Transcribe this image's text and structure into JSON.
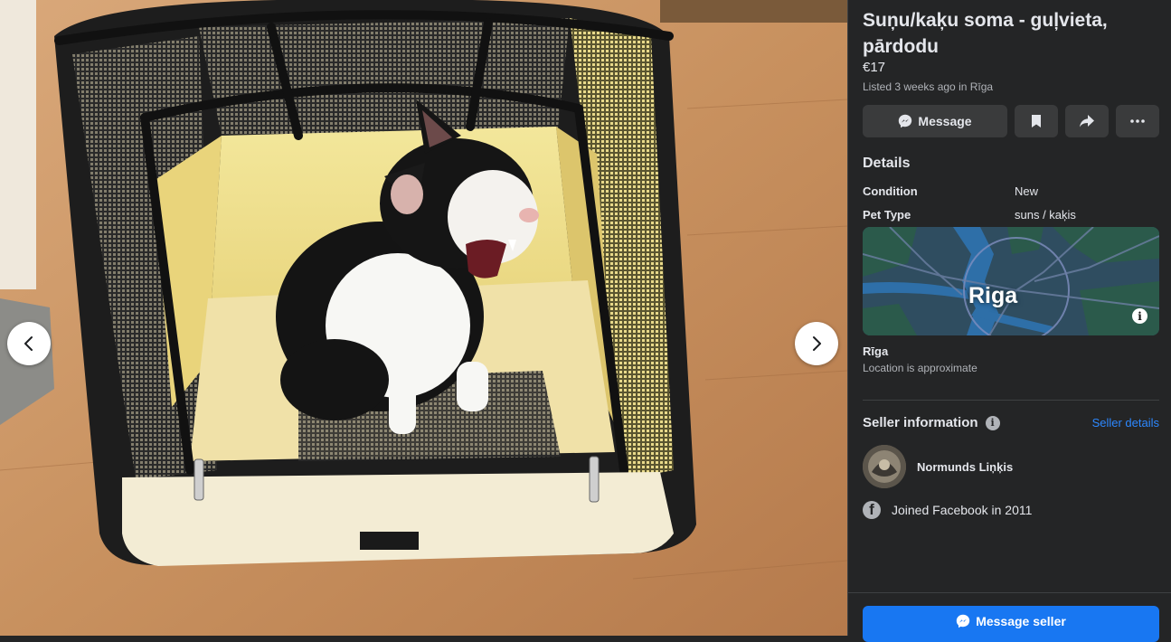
{
  "photo": {
    "alt_icon": "cat-in-pet-carrier-photo",
    "prev_icon": "chevron-left-icon",
    "next_icon": "chevron-right-icon"
  },
  "listing": {
    "title": "Suņu/kaķu soma - guļvieta, pārdodu",
    "price": "€17",
    "listed_prefix": "Listed 3 weeks ago in ",
    "listed_place": "Rīga"
  },
  "actions": {
    "message_label": "Message",
    "save_icon": "bookmark-icon",
    "share_icon": "share-icon",
    "more_icon": "more-icon"
  },
  "details": {
    "heading": "Details",
    "rows": [
      {
        "key": "Condition",
        "value": "New"
      },
      {
        "key": "Pet Type",
        "value": "suns / kaķis"
      }
    ]
  },
  "location": {
    "map_label": "Riga",
    "name": "Rīga",
    "note": "Location is approximate"
  },
  "seller": {
    "heading": "Seller information",
    "details_link": "Seller details",
    "name": "Normunds Liņķis",
    "joined": "Joined Facebook in 2011"
  },
  "cta": {
    "label": "Message seller"
  },
  "colors": {
    "panel_bg": "#242526",
    "button_bg": "#3a3b3c",
    "accent": "#1877f2",
    "link": "#2d88ff",
    "text_primary": "#e4e6eb",
    "text_secondary": "#b0b3b8"
  }
}
